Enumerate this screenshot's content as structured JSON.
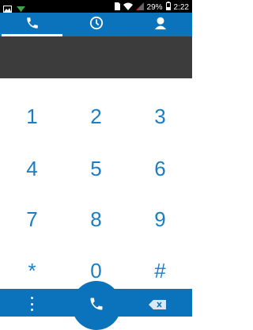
{
  "status_bar": {
    "battery_percent": "29%",
    "time": "2:22",
    "icons": [
      "image-icon",
      "download-icon",
      "sim-icon",
      "wifi-icon",
      "signal-icon",
      "battery-icon"
    ]
  },
  "tabs": [
    {
      "id": "dialer",
      "icon": "phone-icon",
      "active": true
    },
    {
      "id": "recents",
      "icon": "clock-icon",
      "active": false
    },
    {
      "id": "contacts",
      "icon": "contact-icon",
      "active": false
    }
  ],
  "number_display": {
    "value": ""
  },
  "keypad": {
    "keys": [
      "1",
      "2",
      "3",
      "4",
      "5",
      "6",
      "7",
      "8",
      "9",
      "*",
      "0",
      "#"
    ]
  },
  "bottom_bar": {
    "menu_icon": "more-vertical-icon",
    "call_icon": "phone-icon",
    "delete_icon": "backspace-icon"
  },
  "colors": {
    "accent": "#0a73bb",
    "key_text": "#1b7dc2",
    "display_background": "#3c3c3c"
  }
}
